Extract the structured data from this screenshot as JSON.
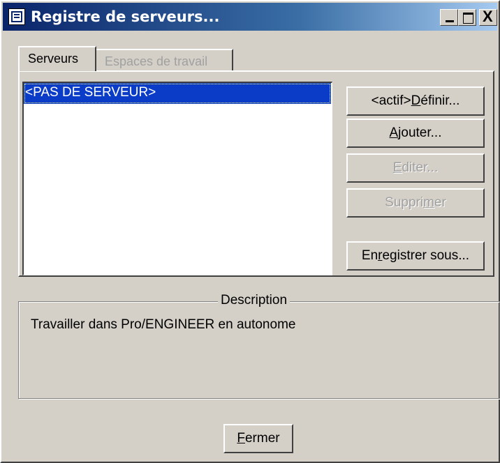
{
  "window": {
    "title": "Registre de serveurs...",
    "controls": [
      "minimize-icon",
      "maximize-icon",
      "close-icon"
    ],
    "close_glyph": "X"
  },
  "tabs": [
    {
      "label": "Serveurs",
      "active": true
    },
    {
      "label": "Espaces de travail",
      "active": false
    }
  ],
  "server_list": {
    "items": [
      {
        "label": "<PAS DE SERVEUR>",
        "selected": true
      }
    ]
  },
  "buttons": {
    "define": {
      "prefix": "<actif>",
      "mnemonic": "D",
      "rest": "éfinir...",
      "enabled": true
    },
    "add": {
      "mnemonic": "A",
      "rest": "jouter...",
      "enabled": true
    },
    "edit": {
      "mnemonic": "E",
      "rest": "diter...",
      "enabled": false
    },
    "delete": {
      "before": "Suppri",
      "mnemonic": "m",
      "rest": "er",
      "enabled": false
    },
    "save_as": {
      "before": "En",
      "mnemonic": "r",
      "rest": "egistrer sous...",
      "enabled": true
    }
  },
  "description": {
    "legend": "Description",
    "text": "Travailler dans Pro/ENGINEER en autonome"
  },
  "footer": {
    "close": {
      "mnemonic": "F",
      "rest": "ermer"
    }
  },
  "colors": {
    "titlebar_start": "#0a246a",
    "titlebar_end": "#a6caf0",
    "selection": "#0a3cc8",
    "face": "#d4d0c8"
  }
}
